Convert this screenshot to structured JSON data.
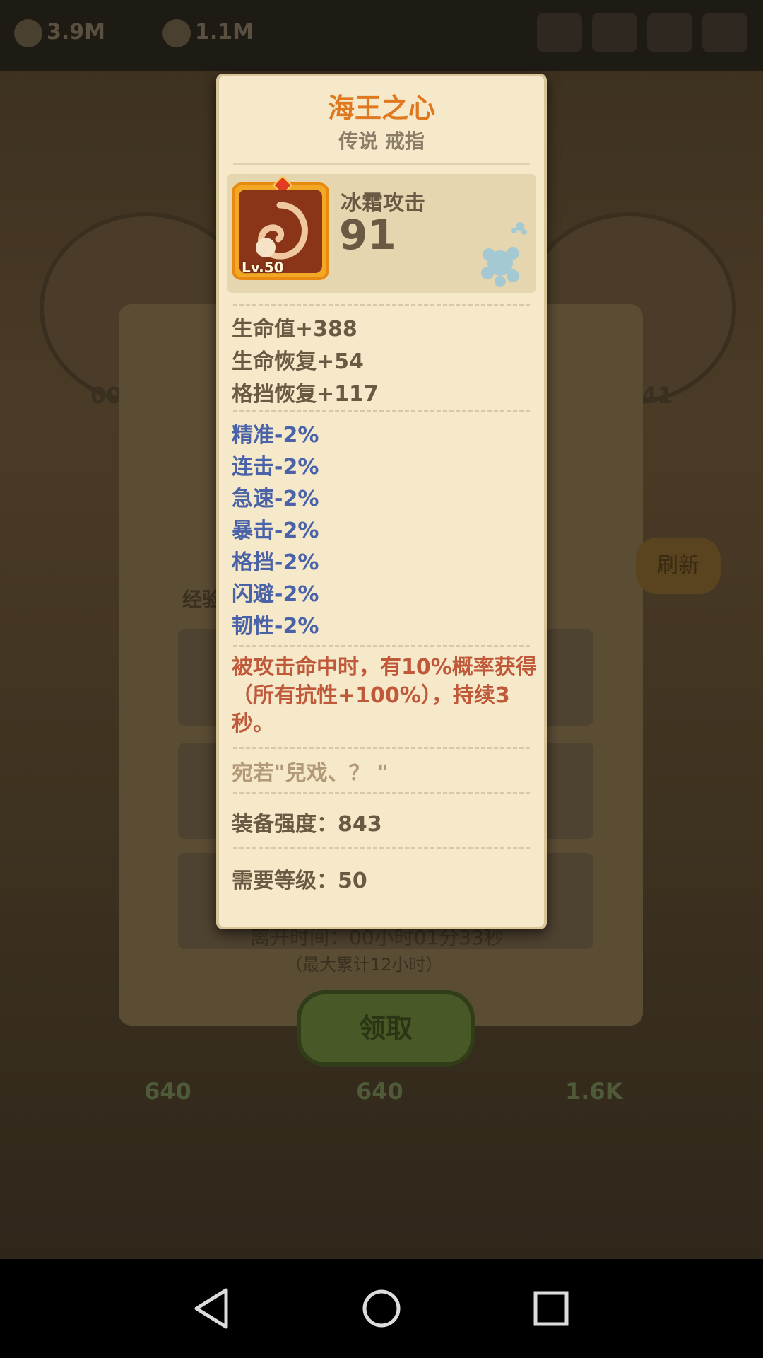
{
  "background": {
    "top_stats": [
      "3.9M",
      "1.1M"
    ],
    "side_numbers": [
      "00",
      "41"
    ],
    "section_label": "经验",
    "refresh_label": "刷新",
    "offline_time": "离开时间：00小时01分33秒",
    "offline_max": "（最大累计12小时）",
    "claim_label": "领取",
    "rewards": [
      "640",
      "640",
      "1.6K"
    ]
  },
  "tooltip": {
    "title": "海王之心",
    "subtitle": "传说 戒指",
    "item_level": "Lv.50",
    "attack_label": "冰霜攻击",
    "attack_value": "91",
    "basic_stats": [
      "生命值+388",
      "生命恢复+54",
      "格挡恢复+117"
    ],
    "negative_stats": [
      "精准-2%",
      "连击-2%",
      "急速-2%",
      "暴击-2%",
      "格挡-2%",
      "闪避-2%",
      "韧性-2%"
    ],
    "effect_description": "被攻击命中时，有10%概率获得（所有抗性+100%），持续3秒。",
    "flavor_text": "宛若\"兒戏、？ \"",
    "power": "装备强度：843",
    "required_level": "需要等级：50"
  },
  "colors": {
    "title": "#e07820",
    "negative_stat": "#4a62a8",
    "effect": "#c0583a",
    "parchment": "#f5e9c9"
  },
  "icons": [
    "back-triangle-icon",
    "home-circle-icon",
    "recents-square-icon",
    "snowflake-icon",
    "ring-icon"
  ]
}
